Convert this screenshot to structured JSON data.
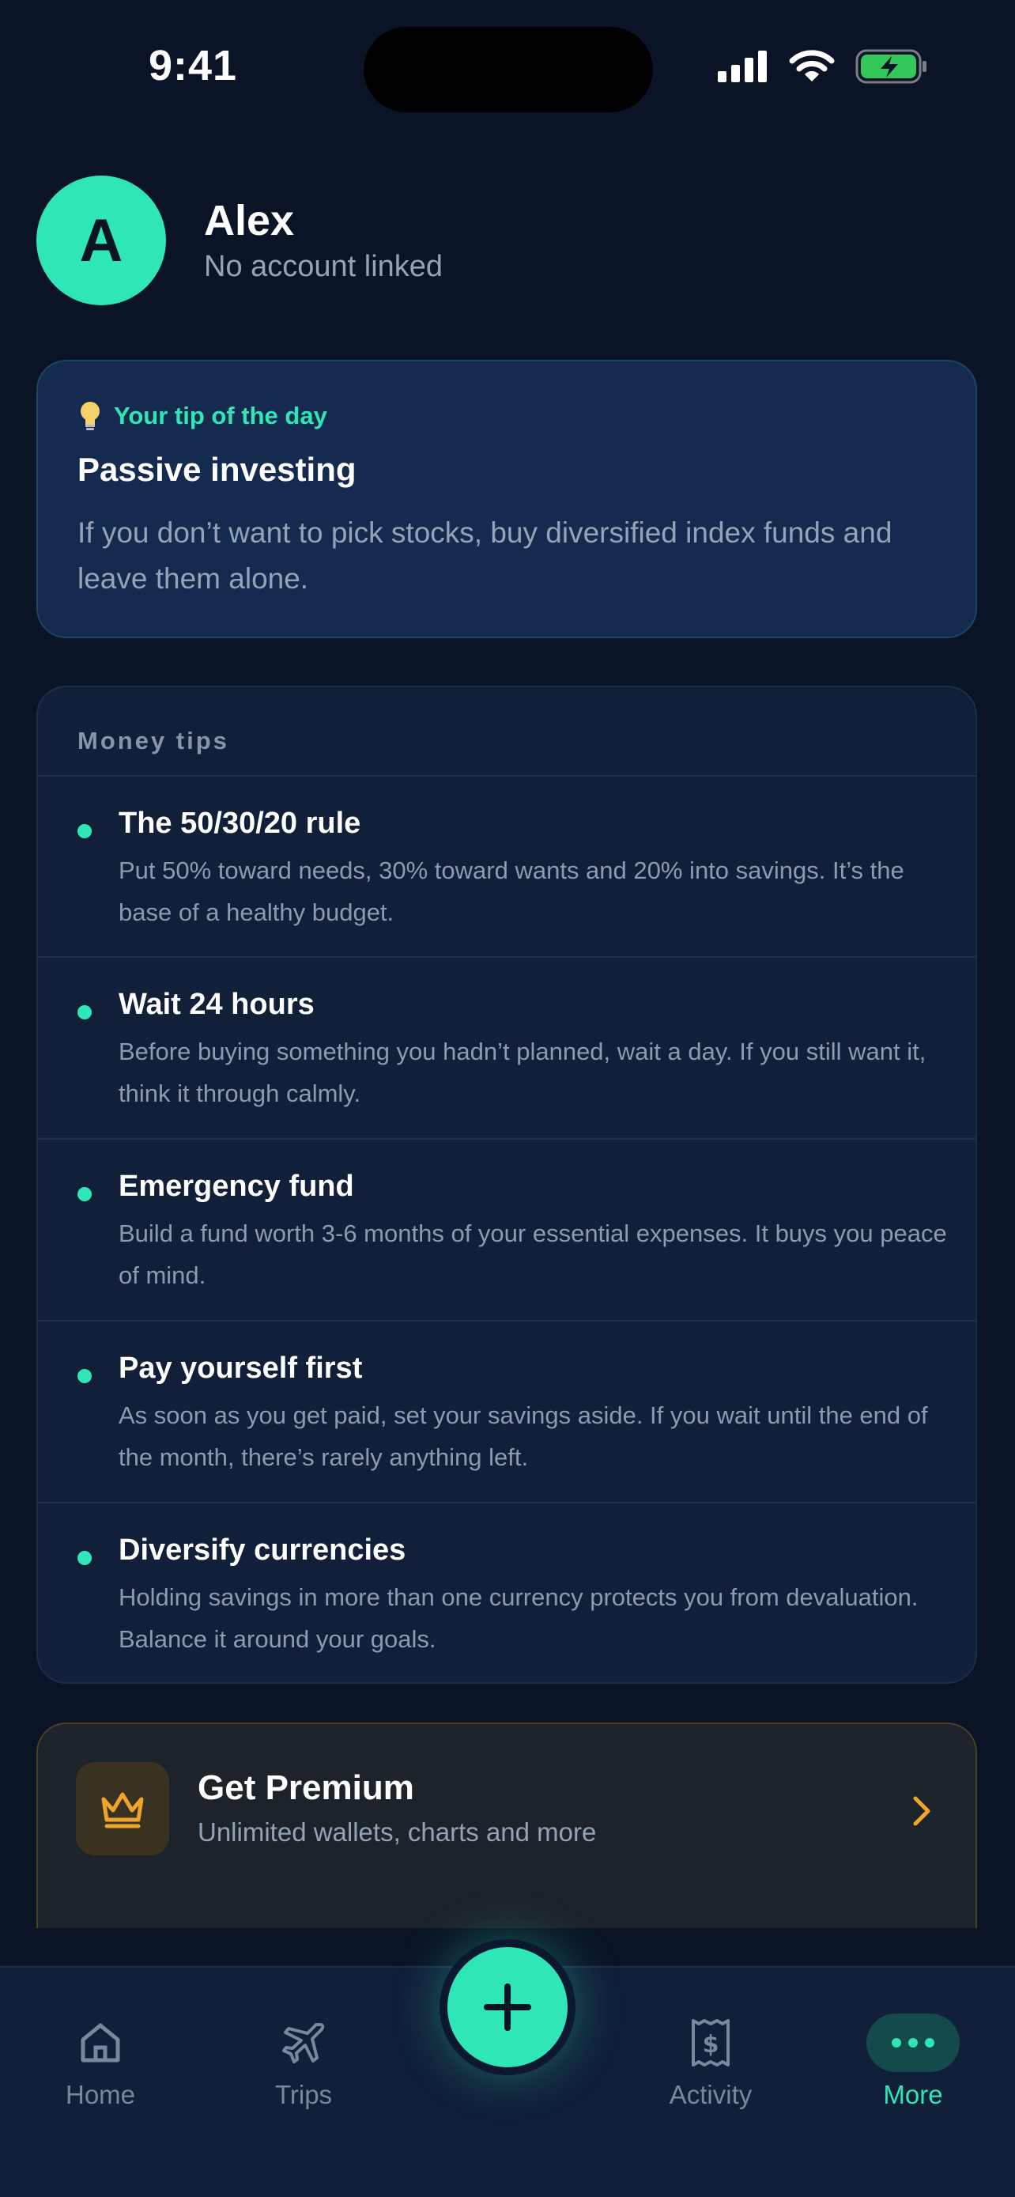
{
  "status_bar": {
    "time": "9:41"
  },
  "profile": {
    "initial": "A",
    "name": "Alex",
    "subtitle": "No account linked"
  },
  "tip_of_day": {
    "kicker": "Your tip of the day",
    "title": "Passive investing",
    "body": "If you don’t want to pick stocks, buy diversified index funds and leave them alone."
  },
  "money_tips": {
    "header": "Money tips",
    "items": [
      {
        "title": "The 50/30/20 rule",
        "desc": "Put 50% toward needs, 30% toward wants and 20% into savings. It’s the base of a healthy budget."
      },
      {
        "title": "Wait 24 hours",
        "desc": "Before buying something you hadn’t planned, wait a day. If you still want it, think it through calmly."
      },
      {
        "title": "Emergency fund",
        "desc": "Build a fund worth 3-6 months of your essential expenses. It buys you peace of mind."
      },
      {
        "title": "Pay yourself first",
        "desc": "As soon as you get paid, set your savings aside. If you wait until the end of the month, there’s rarely anything left."
      },
      {
        "title": "Diversify currencies",
        "desc": "Holding savings in more than one currency protects you from devaluation. Balance it around your goals."
      }
    ]
  },
  "premium": {
    "title": "Get Premium",
    "subtitle": "Unlimited wallets, charts and more",
    "icon": "crown-icon"
  },
  "tabbar": {
    "tabs": [
      {
        "label": "Home",
        "icon": "home-icon"
      },
      {
        "label": "Trips",
        "icon": "plane-icon"
      },
      {
        "label": "Activity",
        "icon": "receipt-icon"
      },
      {
        "label": "More",
        "icon": "more-icon",
        "active": true
      }
    ],
    "fab_icon": "plus-icon"
  },
  "colors": {
    "accent": "#2ee6b6",
    "background": "#0a1426",
    "premium_gold": "#f0a52a"
  }
}
